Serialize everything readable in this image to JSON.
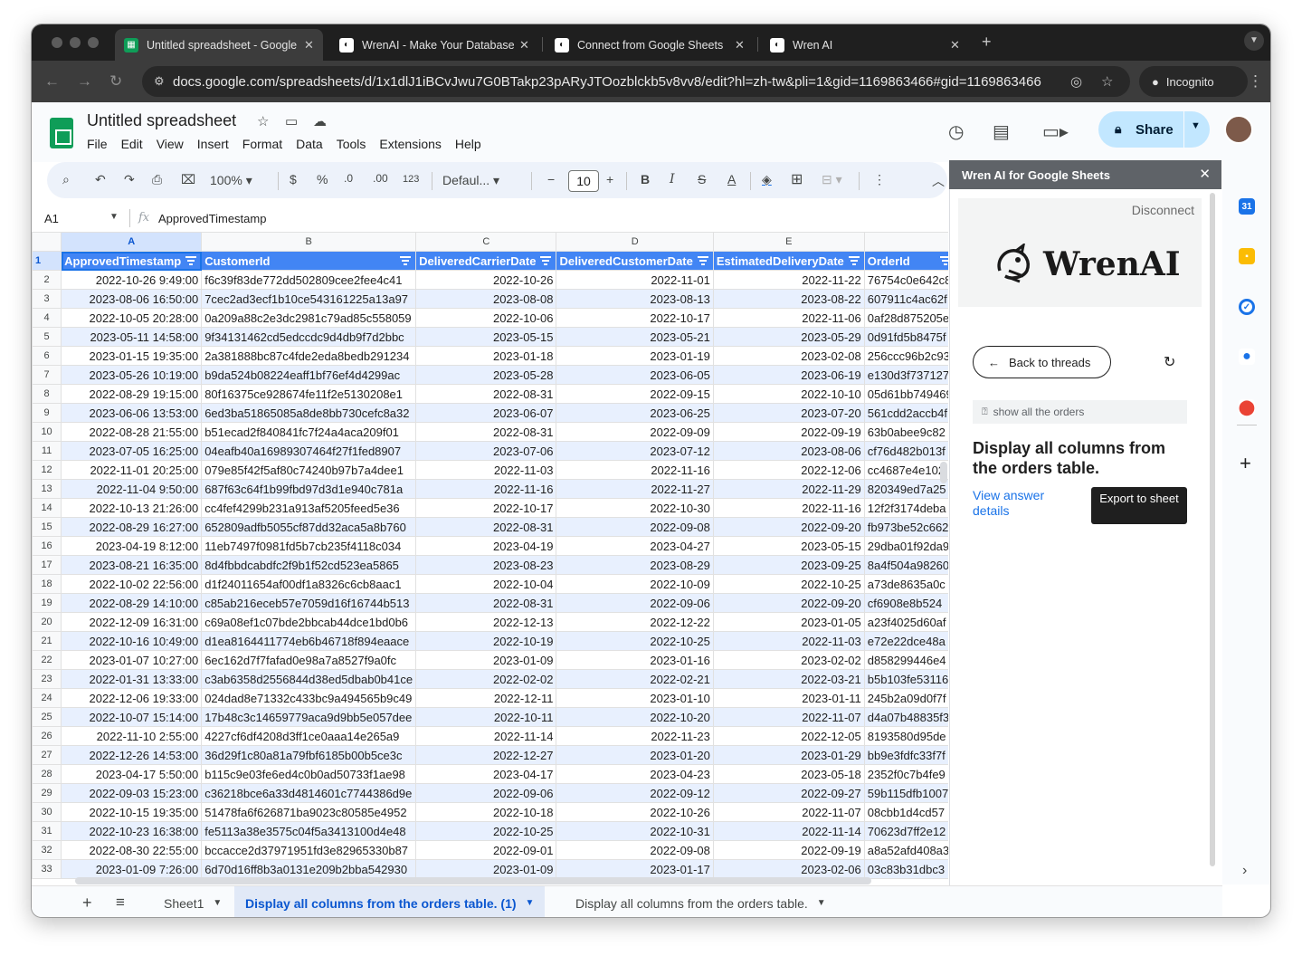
{
  "browser": {
    "tabs": [
      {
        "title": "Untitled spreadsheet - Google Sheets",
        "favicon": "sheets-icon",
        "active": true
      },
      {
        "title": "WrenAI - Make Your Database RAG-Ready",
        "favicon": "wren-icon",
        "active": false
      },
      {
        "title": "Connect from Google Sheets",
        "favicon": "wren-icon",
        "active": false
      },
      {
        "title": "Wren AI",
        "favicon": "wren-icon",
        "active": false
      }
    ],
    "url": "docs.google.com/spreadsheets/d/1x1dlJ1iBCvJwu7G0BTakp23pARyJTOozblckb5v8vv8/edit?hl=zh-tw&pli=1&gid=1169863466#gid=1169863466",
    "incognito_label": "Incognito"
  },
  "sheets": {
    "title": "Untitled spreadsheet",
    "menu": [
      "File",
      "Edit",
      "View",
      "Insert",
      "Format",
      "Data",
      "Tools",
      "Extensions",
      "Help"
    ],
    "share_label": "Share",
    "toolbar": {
      "zoom": "100%",
      "currency": "$",
      "percent": "%",
      "dec_minus": ".0",
      "dec_plus": ".00",
      "number_format": "123",
      "font": "Defaul...",
      "font_size": "10"
    },
    "name_box": "A1",
    "formula": "ApprovedTimestamp",
    "fx": "fx"
  },
  "grid": {
    "columns": [
      "A",
      "B",
      "C",
      "D",
      "E",
      ""
    ],
    "header": [
      "ApprovedTimestamp",
      "CustomerId",
      "DeliveredCarrierDate",
      "DeliveredCustomerDate",
      "EstimatedDeliveryDate",
      "OrderId"
    ],
    "rows": [
      [
        "2022-10-26 9:49:00",
        "f6c39f83de772dd502809cee2fee4c41",
        "2022-10-26",
        "2022-11-01",
        "2022-11-22",
        "76754c0e642c8"
      ],
      [
        "2023-08-06 16:50:00",
        "7cec2ad3ecf1b10ce543161225a13a97",
        "2023-08-08",
        "2023-08-13",
        "2023-08-22",
        "607911c4ac62f"
      ],
      [
        "2022-10-05 20:28:00",
        "0a209a88c2e3dc2981c79ad85c558059",
        "2022-10-06",
        "2022-10-17",
        "2022-11-06",
        "0af28d875205e"
      ],
      [
        "2023-05-11 14:58:00",
        "9f34131462cd5edccdc9d4db9f7d2bbc",
        "2023-05-15",
        "2023-05-21",
        "2023-05-29",
        "0d91fd5b8475f"
      ],
      [
        "2023-01-15 19:35:00",
        "2a381888bc87c4fde2eda8bedb291234",
        "2023-01-18",
        "2023-01-19",
        "2023-02-08",
        "256ccc96b2c93"
      ],
      [
        "2023-05-26 10:19:00",
        "b9da524b08224eaff1bf76ef4d4299ac",
        "2023-05-28",
        "2023-06-05",
        "2023-06-19",
        "e130d3f737127"
      ],
      [
        "2022-08-29 19:15:00",
        "80f16375ce928674fe11f2e5130208e1",
        "2022-08-31",
        "2022-09-15",
        "2022-10-10",
        "05d61bb749469"
      ],
      [
        "2023-06-06 13:53:00",
        "6ed3ba51865085a8de8bb730cefc8a32",
        "2023-06-07",
        "2023-06-25",
        "2023-07-20",
        "561cdd2accb4f"
      ],
      [
        "2022-08-28 21:55:00",
        "b51ecad2f840841fc7f24a4aca209f01",
        "2022-08-31",
        "2022-09-09",
        "2022-09-19",
        "63b0abee9c82"
      ],
      [
        "2023-07-05 16:25:00",
        "04eafb40a16989307464f27f1fed8907",
        "2023-07-06",
        "2023-07-12",
        "2023-08-06",
        "cf76d482b013f"
      ],
      [
        "2022-11-01 20:25:00",
        "079e85f42f5af80c74240b97b7a4dee1",
        "2022-11-03",
        "2022-11-16",
        "2022-12-06",
        "cc4687e4e102"
      ],
      [
        "2022-11-04 9:50:00",
        "687f63c64f1b99fbd97d3d1e940c781a",
        "2022-11-16",
        "2022-11-27",
        "2022-11-29",
        "820349ed7a25"
      ],
      [
        "2022-10-13 21:26:00",
        "cc4fef4299b231a913af5205feed5e36",
        "2022-10-17",
        "2022-10-30",
        "2022-11-16",
        "12f2f3174deba"
      ],
      [
        "2022-08-29 16:27:00",
        "652809adfb5055cf87dd32aca5a8b760",
        "2022-08-31",
        "2022-09-08",
        "2022-09-20",
        "fb973be52c662"
      ],
      [
        "2023-04-19 8:12:00",
        "11eb7497f0981fd5b7cb235f4118c034",
        "2023-04-19",
        "2023-04-27",
        "2023-05-15",
        "29dba01f92da9"
      ],
      [
        "2023-08-21 16:35:00",
        "8d4fbbdcabdfc2f9b1f52cd523ea5865",
        "2023-08-23",
        "2023-08-29",
        "2023-09-25",
        "8a4f504a98260"
      ],
      [
        "2022-10-02 22:56:00",
        "d1f24011654af00df1a8326c6cb8aac1",
        "2022-10-04",
        "2022-10-09",
        "2022-10-25",
        "a73de8635a0c"
      ],
      [
        "2022-08-29 14:10:00",
        "c85ab216eceb57e7059d16f16744b513",
        "2022-08-31",
        "2022-09-06",
        "2022-09-20",
        "cf6908e8b524"
      ],
      [
        "2022-12-09 16:31:00",
        "c69a08ef1c07bde2bbcab44dce1bd0b6",
        "2022-12-13",
        "2022-12-22",
        "2023-01-05",
        "a23f4025d60af"
      ],
      [
        "2022-10-16 10:49:00",
        "d1ea8164411774eb6b46718f894eaace",
        "2022-10-19",
        "2022-10-25",
        "2022-11-03",
        "e72e22dce48a"
      ],
      [
        "2023-01-07 10:27:00",
        "6ec162d7f7fafad0e98a7a8527f9a0fc",
        "2023-01-09",
        "2023-01-16",
        "2023-02-02",
        "d858299446e4"
      ],
      [
        "2022-01-31 13:33:00",
        "c3ab6358d2556844d38ed5dbab0b41ce",
        "2022-02-02",
        "2022-02-21",
        "2022-03-21",
        "b5b103fe53116"
      ],
      [
        "2022-12-06 19:33:00",
        "024dad8e71332c433bc9a494565b9c49",
        "2022-12-11",
        "2023-01-10",
        "2023-01-11",
        "245b2a09d0f7f"
      ],
      [
        "2022-10-07 15:14:00",
        "17b48c3c14659779aca9d9bb5e057dee",
        "2022-10-11",
        "2022-10-20",
        "2022-11-07",
        "d4a07b48835f3"
      ],
      [
        "2022-11-10 2:55:00",
        "4227cf6df4208d3ff1ce0aaa14e265a9",
        "2022-11-14",
        "2022-11-23",
        "2022-12-05",
        "8193580d95de"
      ],
      [
        "2022-12-26 14:53:00",
        "36d29f1c80a81a79fbf6185b00b5ce3c",
        "2022-12-27",
        "2023-01-20",
        "2023-01-29",
        "bb9e3fdfc33f7f"
      ],
      [
        "2023-04-17 5:50:00",
        "b115c9e03fe6ed4c0b0ad50733f1ae98",
        "2023-04-17",
        "2023-04-23",
        "2023-05-18",
        "2352f0c7b4fe9"
      ],
      [
        "2022-09-03 15:23:00",
        "c36218bce6a33d4814601c7744386d9e",
        "2022-09-06",
        "2022-09-12",
        "2022-09-27",
        "59b115dfb1007"
      ],
      [
        "2022-10-15 19:35:00",
        "51478fa6f626871ba9023c80585e4952",
        "2022-10-18",
        "2022-10-26",
        "2022-11-07",
        "08cbb1d4cd57"
      ],
      [
        "2022-10-23 16:38:00",
        "fe5113a38e3575c04f5a3413100d4e48",
        "2022-10-25",
        "2022-10-31",
        "2022-11-14",
        "70623d7ff2e12"
      ],
      [
        "2022-08-30 22:55:00",
        "bccacce2d37971951fd3e82965330b87",
        "2022-09-01",
        "2022-09-08",
        "2022-09-19",
        "a8a52afd408a3"
      ],
      [
        "2023-01-09 7:26:00",
        "6d70d16ff8b3a0131e209b2bba542930",
        "2023-01-09",
        "2023-01-17",
        "2023-02-06",
        "03c83b31dbc3"
      ]
    ]
  },
  "sidebar": {
    "title": "Wren AI for Google Sheets",
    "disconnect": "Disconnect",
    "logo_text": "WrenAI",
    "back_label": "Back to threads",
    "question": "show all the orders",
    "answer_title": "Display all columns from the orders table.",
    "view_details": "View answer details",
    "export_label": "Export to sheet"
  },
  "sheet_tabs": [
    {
      "label": "Sheet1",
      "active": false
    },
    {
      "label": "Display all columns from the orders table. (1)",
      "active": true
    },
    {
      "label": "Display all columns from the orders table.",
      "active": false
    }
  ],
  "colors": {
    "header_blue": "#4285f4",
    "band_blue": "#e8f0fe",
    "share_bg": "#c2e7ff",
    "sheets_green": "#0f9d58"
  }
}
